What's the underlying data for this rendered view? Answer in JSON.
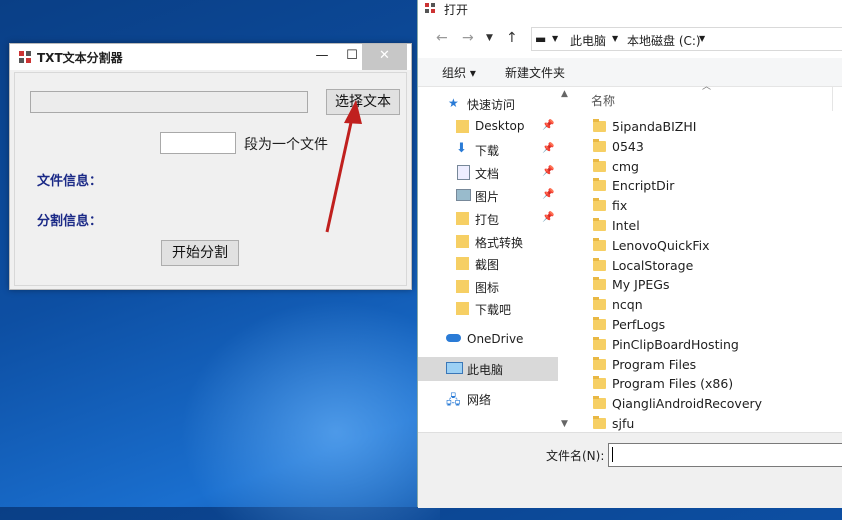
{
  "app": {
    "title": "TXT文本分割器",
    "minimize": "—",
    "maximize": "☐",
    "close": "✕",
    "path_value": "",
    "select_button": "选择文本",
    "segment_value": "",
    "segment_label": "段为一个文件",
    "file_info_label": "文件信息：",
    "split_info_label": "分割信息：",
    "start_button": "开始分割"
  },
  "explorer": {
    "title": "打开",
    "breadcrumbs": [
      "此电脑",
      "本地磁盘 (C:)"
    ],
    "toolbar": {
      "organize": "组织 ▾",
      "new_folder": "新建文件夹"
    },
    "nav_items": [
      {
        "label": "快速访问",
        "icon": "star-icon",
        "pinned": false
      },
      {
        "label": "Desktop",
        "icon": "folder-icon",
        "pinned": true
      },
      {
        "label": "下载",
        "icon": "download-icon",
        "pinned": true
      },
      {
        "label": "文档",
        "icon": "document-icon",
        "pinned": true
      },
      {
        "label": "图片",
        "icon": "picture-icon",
        "pinned": true
      },
      {
        "label": "打包",
        "icon": "folder-icon",
        "pinned": true
      },
      {
        "label": "格式转换",
        "icon": "folder-icon",
        "pinned": false
      },
      {
        "label": "截图",
        "icon": "folder-icon",
        "pinned": false
      },
      {
        "label": "图标",
        "icon": "folder-icon",
        "pinned": false
      },
      {
        "label": "下载吧",
        "icon": "folder-icon",
        "pinned": false
      },
      {
        "label": "OneDrive",
        "icon": "cloud-icon",
        "pinned": false
      },
      {
        "label": "此电脑",
        "icon": "computer-icon",
        "pinned": false
      },
      {
        "label": "网络",
        "icon": "network-icon",
        "pinned": false
      }
    ],
    "column_header": "名称",
    "files": [
      "5ipandaBIZHI",
      "0543",
      "cmg",
      "EncriptDir",
      "fix",
      "Intel",
      "LenovoQuickFix",
      "LocalStorage",
      "My JPEGs",
      "ncqn",
      "PerfLogs",
      "PinClipBoardHosting",
      "Program Files",
      "Program Files (x86)",
      "QiangliAndroidRecovery",
      "sjfu"
    ],
    "filename_label": "文件名(N):",
    "filename_value": ""
  },
  "colors": {
    "accent": "#1b2a87",
    "arrow": "#c0201e",
    "folder": "#f6cf64",
    "desktop": "#0d4fa3"
  }
}
